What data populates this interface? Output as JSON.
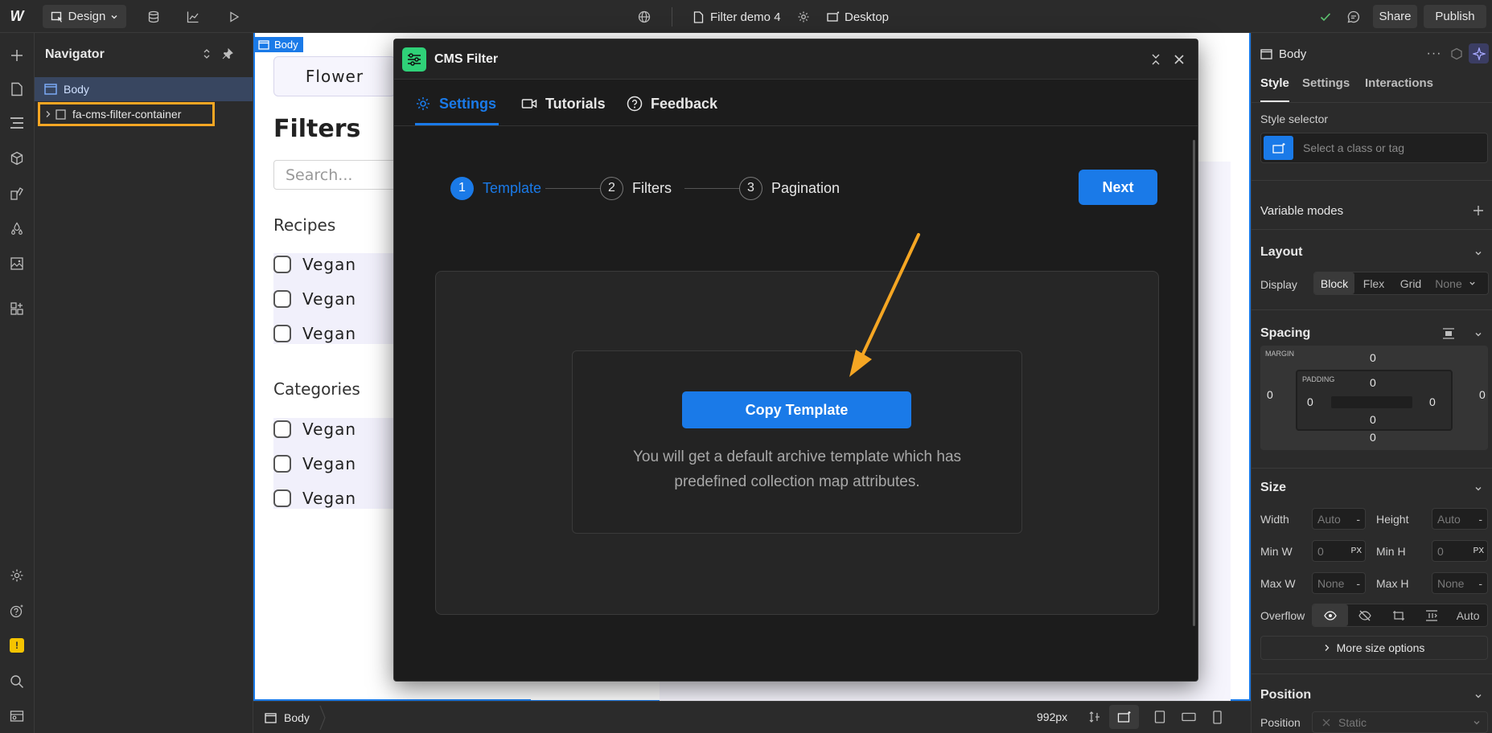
{
  "topbar": {
    "mode_label": "Design",
    "page_name": "Filter demo 4",
    "breakpoint_label": "Desktop",
    "share_label": "Share",
    "publish_label": "Publish"
  },
  "navigator": {
    "title": "Navigator",
    "items": [
      {
        "label": "Body"
      },
      {
        "label": "fa-cms-filter-container"
      }
    ]
  },
  "canvas": {
    "body_tag": "Body",
    "tab_label": "Flower",
    "heading": "Filters",
    "search_placeholder": "Search...",
    "recipes_label": "Recipes",
    "recipes_items": [
      "Vegan",
      "Vegan",
      "Vegan"
    ],
    "categories_label": "Categories",
    "categories_items": [
      "Vegan",
      "Vegan",
      "Vegan"
    ]
  },
  "modal": {
    "title": "CMS Filter",
    "tabs": [
      {
        "label": "Settings",
        "active": true
      },
      {
        "label": "Tutorials"
      },
      {
        "label": "Feedback"
      }
    ],
    "steps": [
      {
        "number": "1",
        "label": "Template",
        "active": true
      },
      {
        "number": "2",
        "label": "Filters"
      },
      {
        "number": "3",
        "label": "Pagination"
      }
    ],
    "next_label": "Next",
    "copy_template_label": "Copy Template",
    "description_line1": "You will get a default archive template which has",
    "description_line2": "predefined collection map attributes.",
    "accent_color": "#1a7ae8",
    "annotation_arrow_color": "#f5a623"
  },
  "right_panel": {
    "element_label": "Body",
    "tabs": [
      "Style",
      "Settings",
      "Interactions"
    ],
    "style_selector_label": "Style selector",
    "style_selector_placeholder": "Select a class or tag",
    "variable_modes_label": "Variable modes",
    "layout": {
      "title": "Layout",
      "display_label": "Display",
      "options": [
        "Block",
        "Flex",
        "Grid",
        "None"
      ]
    },
    "spacing": {
      "title": "Spacing",
      "margin_label": "MARGIN",
      "padding_label": "PADDING",
      "margin_top": "0",
      "margin_right": "0",
      "margin_bottom": "0",
      "margin_left": "0",
      "padding_top": "0",
      "padding_right": "0",
      "padding_bottom": "0",
      "padding_left": "0"
    },
    "size": {
      "title": "Size",
      "width_label": "Width",
      "width_value": "Auto",
      "height_label": "Height",
      "height_value": "Auto",
      "minw_label": "Min W",
      "minw_value": "0",
      "minh_label": "Min H",
      "minh_value": "0",
      "maxw_label": "Max W",
      "maxw_value": "None",
      "maxh_label": "Max H",
      "maxh_value": "None",
      "unit_px": "PX",
      "unit_dash": "-",
      "overflow_label": "Overflow",
      "overflow_auto": "Auto",
      "more_label": "More size options"
    },
    "position": {
      "title": "Position",
      "label": "Position",
      "value": "Static"
    }
  },
  "bottombar": {
    "breadcrumb": "Body",
    "width_readout": "992px"
  }
}
